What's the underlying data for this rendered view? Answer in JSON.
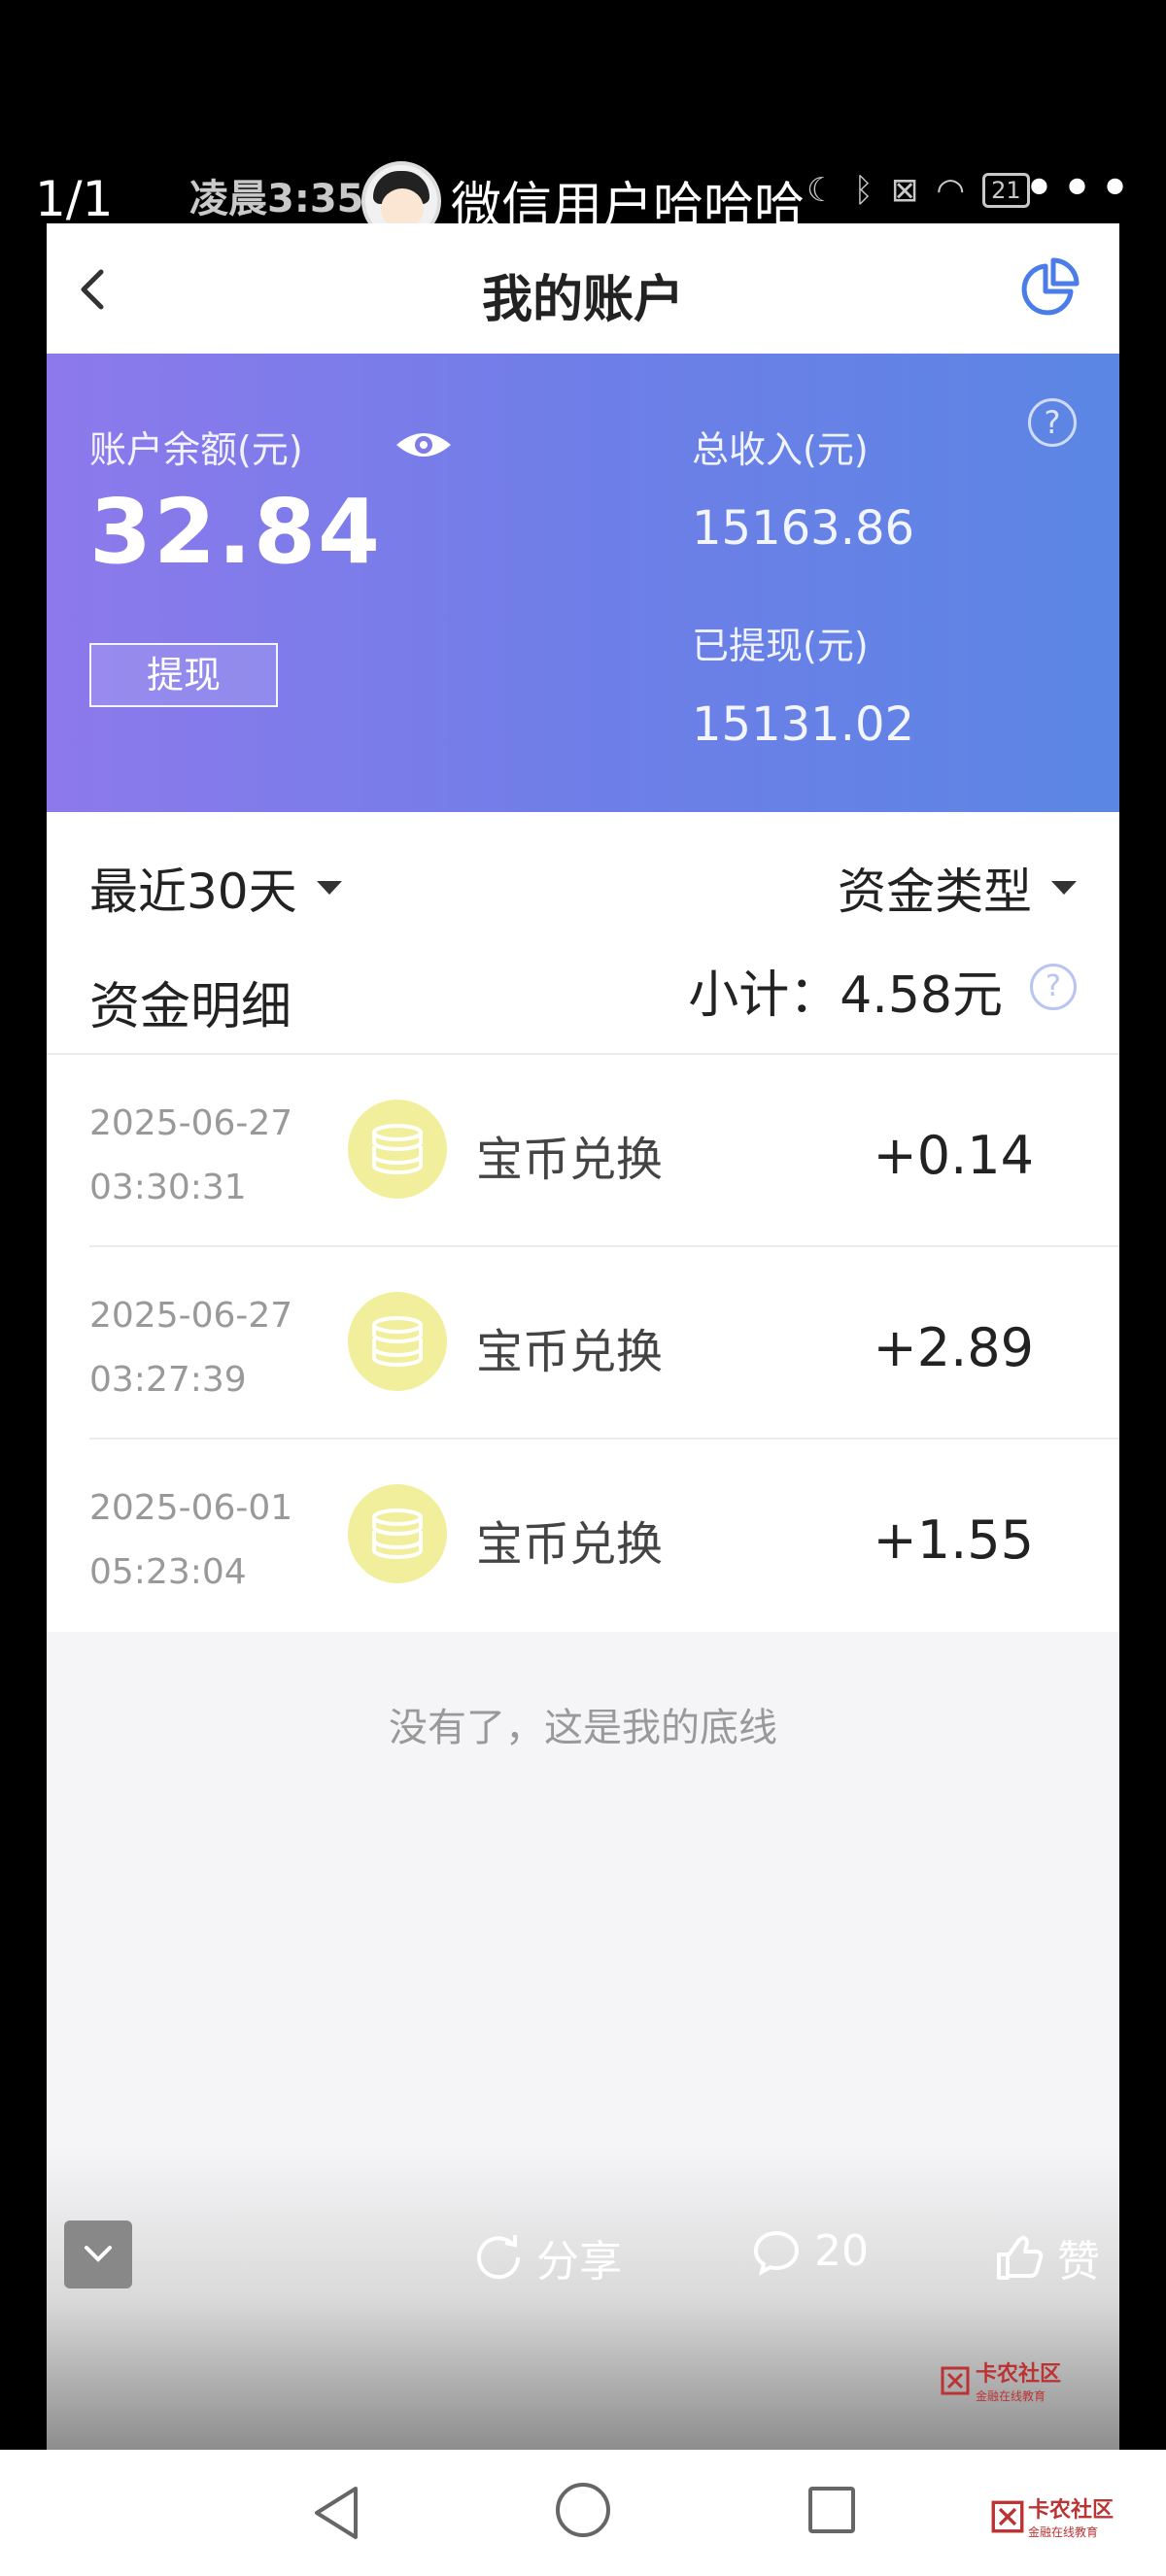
{
  "viewer": {
    "page_count": "1/1",
    "status_time": "凌晨3:35",
    "battery": "21",
    "user_name": "微信用户哈哈哈",
    "more": "•••"
  },
  "header": {
    "title": "我的账户"
  },
  "account": {
    "balance_label": "账户余额(元)",
    "balance": "32.84",
    "withdraw_button": "提现",
    "income_label": "总收入(元)",
    "income": "15163.86",
    "withdrawn_label": "已提现(元)",
    "withdrawn": "15131.02",
    "help": "?"
  },
  "filters": {
    "period": "最近30天",
    "fund_type": "资金类型"
  },
  "details": {
    "title": "资金明细",
    "subtotal": "小计：4.58元",
    "help": "?",
    "rows": [
      {
        "date": "2025-06-27",
        "time": "03:30:31",
        "name": "宝币兑换",
        "amount": "+0.14"
      },
      {
        "date": "2025-06-27",
        "time": "03:27:39",
        "name": "宝币兑换",
        "amount": "+2.89"
      },
      {
        "date": "2025-06-01",
        "time": "05:23:04",
        "name": "宝币兑换",
        "amount": "+1.55"
      }
    ],
    "end_text": "没有了，这是我的底线"
  },
  "actions": {
    "share": "分享",
    "comments": "20",
    "like": "赞"
  },
  "watermark": {
    "text": "卡农社区",
    "sub": "金融在线教育"
  }
}
